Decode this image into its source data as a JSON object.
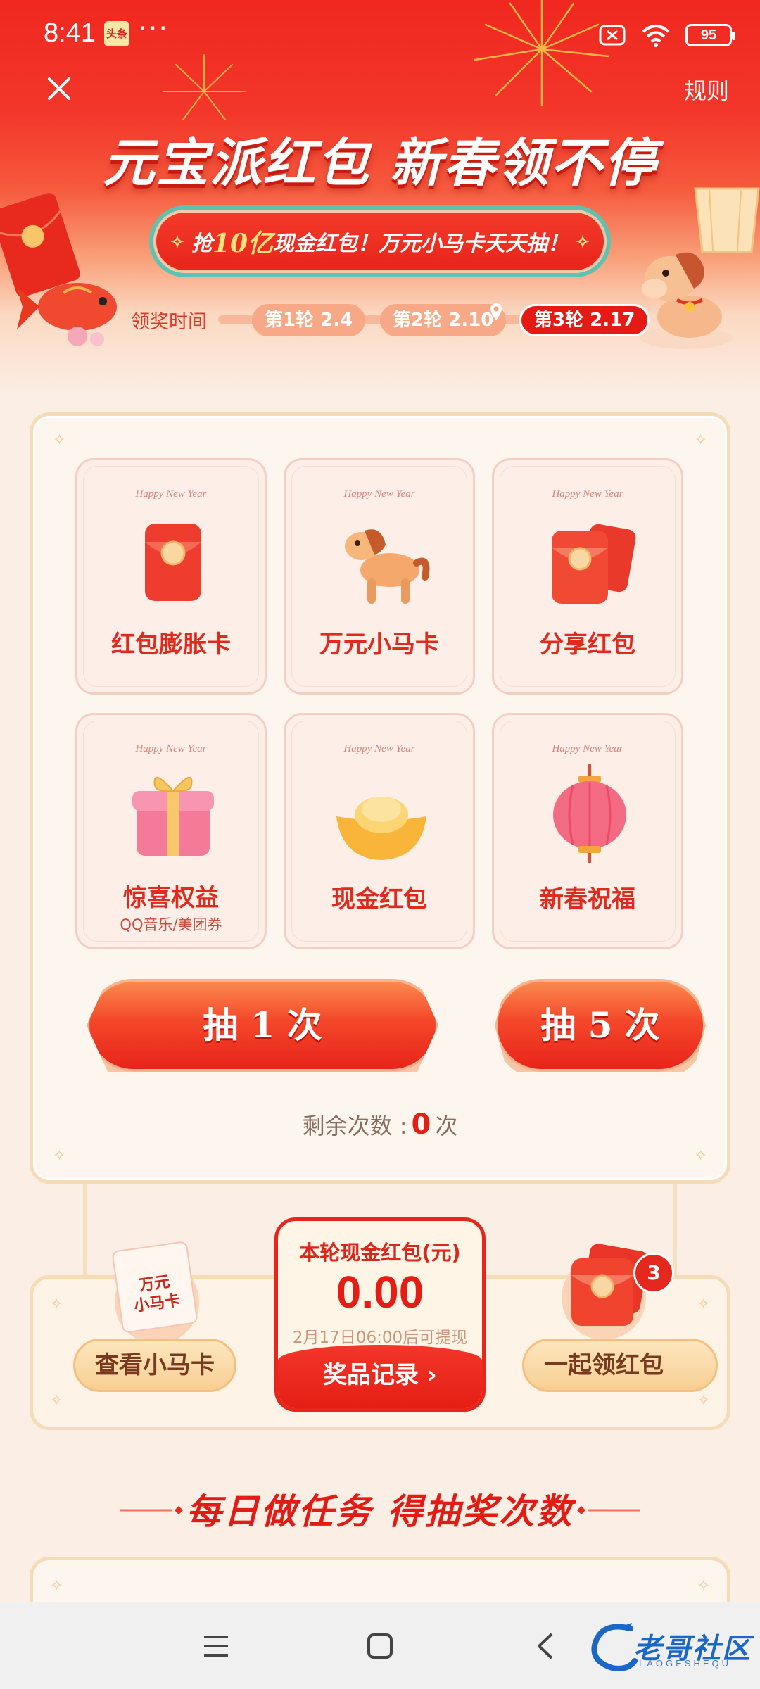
{
  "status_bar": {
    "time": "8:41",
    "app_badge": "头条",
    "more": "···",
    "battery": "95"
  },
  "header": {
    "rules": "规则",
    "title": "元宝派红包 新春领不停",
    "banner_prefix": "抢",
    "banner_highlight": "10亿",
    "banner_suffix": "现金红包！万元小马卡天天抽！",
    "claim_time_label": "领奖时间",
    "rounds": [
      {
        "label": "第1轮 2.4"
      },
      {
        "label": "第2轮 2.10"
      },
      {
        "label": "第3轮 2.17"
      }
    ],
    "accent_color": "#e61a14"
  },
  "prizes": {
    "tile_caption": "Happy New Year",
    "items": [
      {
        "label": "红包膨胀卡",
        "icon": "red-envelope-icon"
      },
      {
        "label": "万元小马卡",
        "icon": "horse-icon"
      },
      {
        "label": "分享红包",
        "icon": "double-red-envelope-icon"
      },
      {
        "label": "惊喜权益",
        "sub": "QQ音乐/美团券",
        "icon": "gift-box-icon"
      },
      {
        "label": "现金红包",
        "icon": "gold-ingot-icon"
      },
      {
        "label": "新春祝福",
        "icon": "lantern-icon"
      }
    ]
  },
  "draw": {
    "draw_once": "抽 1 次",
    "draw_five": "抽 5 次",
    "remaining_prefix": "剩余次数 :",
    "remaining_count": "0",
    "remaining_suffix": "次"
  },
  "actions": {
    "view_horse_card": "查看小马卡",
    "horse_card_icon_text": "万元\n小马卡",
    "claim_together": "一起领红包",
    "claim_badge": "3",
    "cash_title": "本轮现金红包(元)",
    "cash_amount": "0.00",
    "cash_note": "2月17日06:00后可提现",
    "prize_records": "奖品记录 ›"
  },
  "tasks": {
    "title": "每日做任务 得抽奖次数"
  },
  "watermark": {
    "text": "老哥社区",
    "sub": "LAOGESHEQU"
  }
}
